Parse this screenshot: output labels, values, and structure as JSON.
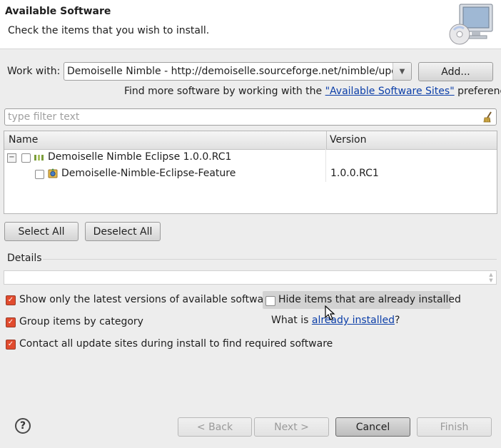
{
  "header": {
    "title": "Available Software",
    "subtitle": "Check the items that you wish to install."
  },
  "work_with": {
    "label": "Work with:",
    "value": "Demoiselle Nimble - http://demoiselle.sourceforge.net/nimble/updates",
    "add_button": "Add...",
    "hint_before": "Find more software by working with the ",
    "hint_link": "\"Available Software Sites\"",
    "hint_after": " preferences."
  },
  "filter": {
    "placeholder": "type filter text"
  },
  "tree": {
    "columns": [
      "Name",
      "Version"
    ],
    "rows": [
      {
        "name": "Demoiselle Nimble Eclipse 1.0.0.RC1",
        "version": ""
      },
      {
        "name": "Demoiselle-Nimble-Eclipse-Feature",
        "version": "1.0.0.RC1"
      }
    ]
  },
  "actions": {
    "select_all": "Select All",
    "deselect_all": "Deselect All"
  },
  "details": {
    "label": "Details"
  },
  "options": {
    "latest_only": "Show only the latest versions of available software",
    "hide_installed": "Hide items that are already installed",
    "group_by_category": "Group items by category",
    "contact_sites": "Contact all update sites during install to find required software",
    "what_is_before": "What is ",
    "what_is_link": "already installed",
    "what_is_after": "?"
  },
  "footer": {
    "back": "< Back",
    "next": "Next >",
    "cancel": "Cancel",
    "finish": "Finish"
  },
  "colors": {
    "accent_check": "#e14b2e",
    "link": "#0b3ea8"
  }
}
